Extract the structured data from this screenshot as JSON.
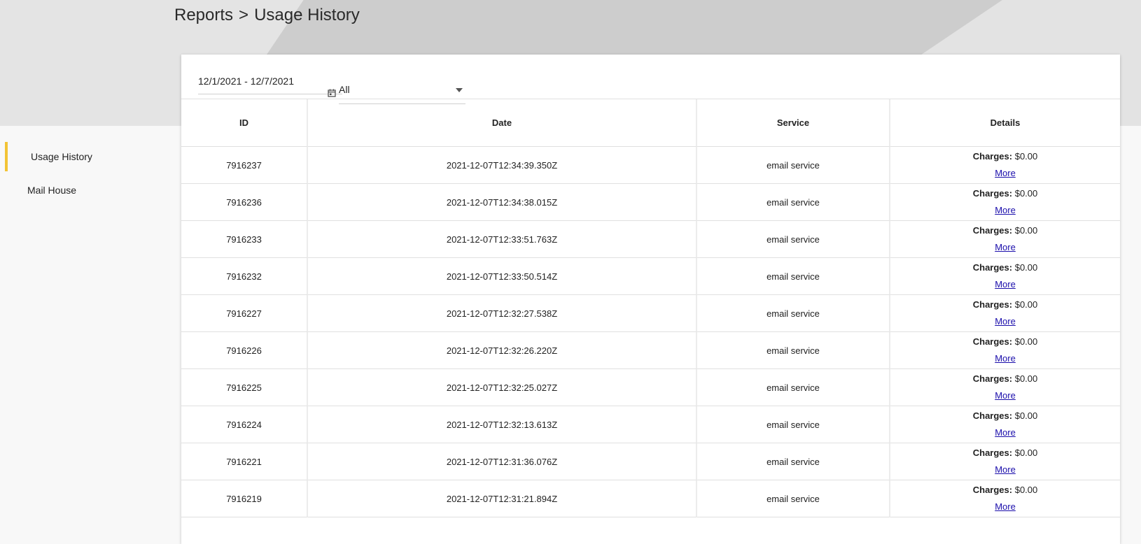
{
  "breadcrumb": {
    "parent": "Reports",
    "separator": ">",
    "current": "Usage History"
  },
  "sidebar": {
    "items": [
      {
        "label": "Usage History",
        "active": true
      },
      {
        "label": "Mail House",
        "active": false
      }
    ],
    "accent_color": "#f2c335"
  },
  "filters": {
    "date_range": "12/1/2021 - 12/7/2021",
    "calendar_icon": "calendar-icon",
    "service_filter": {
      "selected": "All"
    }
  },
  "table": {
    "columns": [
      "ID",
      "Date",
      "Service",
      "Details"
    ],
    "charges_label": "Charges:",
    "more_label": "More",
    "rows": [
      {
        "id": "7916237",
        "date": "2021-12-07T12:34:39.350Z",
        "service": "email service",
        "charges": "$0.00"
      },
      {
        "id": "7916236",
        "date": "2021-12-07T12:34:38.015Z",
        "service": "email service",
        "charges": "$0.00"
      },
      {
        "id": "7916233",
        "date": "2021-12-07T12:33:51.763Z",
        "service": "email service",
        "charges": "$0.00"
      },
      {
        "id": "7916232",
        "date": "2021-12-07T12:33:50.514Z",
        "service": "email service",
        "charges": "$0.00"
      },
      {
        "id": "7916227",
        "date": "2021-12-07T12:32:27.538Z",
        "service": "email service",
        "charges": "$0.00"
      },
      {
        "id": "7916226",
        "date": "2021-12-07T12:32:26.220Z",
        "service": "email service",
        "charges": "$0.00"
      },
      {
        "id": "7916225",
        "date": "2021-12-07T12:32:25.027Z",
        "service": "email service",
        "charges": "$0.00"
      },
      {
        "id": "7916224",
        "date": "2021-12-07T12:32:13.613Z",
        "service": "email service",
        "charges": "$0.00"
      },
      {
        "id": "7916221",
        "date": "2021-12-07T12:31:36.076Z",
        "service": "email service",
        "charges": "$0.00"
      },
      {
        "id": "7916219",
        "date": "2021-12-07T12:31:21.894Z",
        "service": "email service",
        "charges": "$0.00"
      }
    ]
  }
}
